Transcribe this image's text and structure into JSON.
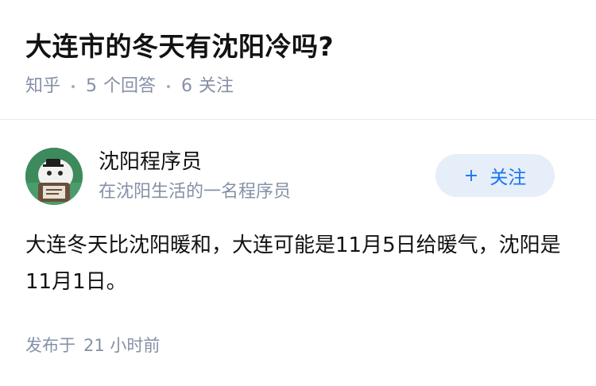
{
  "question": {
    "title": "大连市的冬天有沈阳冷吗?",
    "source": "知乎",
    "answer_count": "5",
    "answer_label": "个回答",
    "follow_count": "6",
    "follow_label": "关注"
  },
  "answer": {
    "author": {
      "name": "沈阳程序员",
      "bio": "在沈阳生活的一名程序员",
      "avatar_icon": "avatar-icon"
    },
    "follow_button": {
      "plus": "+",
      "label": "关注"
    },
    "content": "大连冬天比沈阳暖和，大连可能是11月5日给暖气，沈阳是11月1日。",
    "published_label": "发布于",
    "published_time": "21 小时前"
  },
  "colors": {
    "meta_gray": "#8590a6",
    "button_bg": "#e5eef9",
    "button_text": "#1772f6",
    "avatar_bg": "#3d8a5c"
  }
}
